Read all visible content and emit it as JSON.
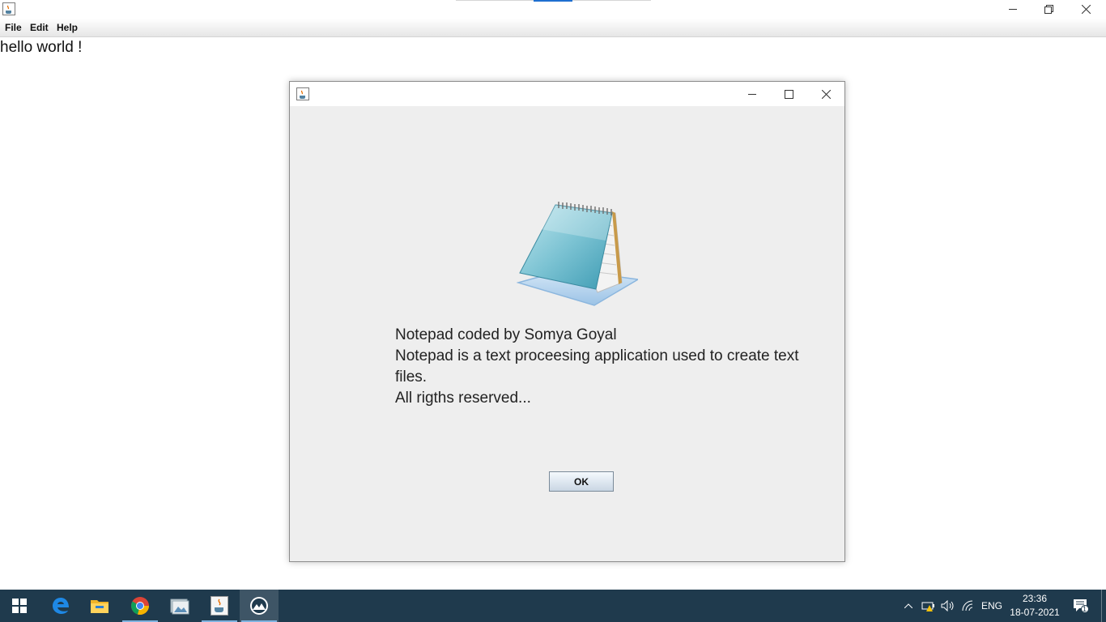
{
  "main_window": {
    "menu": [
      {
        "label": "File"
      },
      {
        "label": "Edit"
      },
      {
        "label": "Help"
      }
    ],
    "editor_text": "hello world !"
  },
  "about_dialog": {
    "lines": [
      "Notepad coded by Somya Goyal",
      "Notepad is a text proceesing application used to create text files.",
      "All rigths reserved..."
    ],
    "ok_label": "OK"
  },
  "taskbar": {
    "apps": [
      {
        "icon": "windows-start-icon"
      },
      {
        "icon": "edge-icon"
      },
      {
        "icon": "file-explorer-icon"
      },
      {
        "icon": "chrome-icon"
      },
      {
        "icon": "photos-icon"
      },
      {
        "icon": "java-icon"
      },
      {
        "icon": "java-app-icon"
      }
    ],
    "tray": {
      "language": "ENG",
      "time": "23:36",
      "date": "18-07-2021",
      "notification_count": "1"
    }
  },
  "colors": {
    "taskbar": "#1f3a4d",
    "dialog_background": "#eeeeee",
    "accent": "#1e6fd0"
  }
}
